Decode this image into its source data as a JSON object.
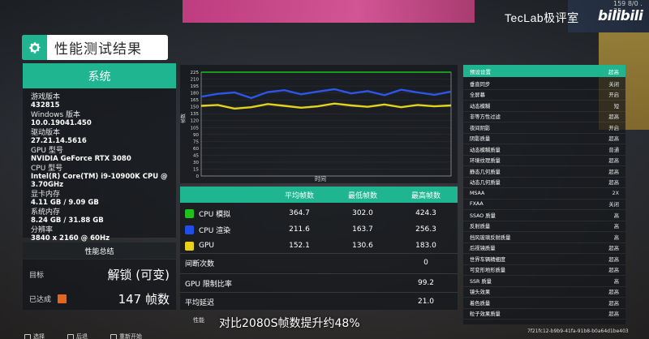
{
  "header": {
    "title": "性能测试结果",
    "watermark": "TecLab极评室",
    "brand": "bilibili",
    "top_corner": "159 8/0 . 35"
  },
  "system": {
    "heading": "系统",
    "rows": [
      {
        "label": "游戏版本",
        "value": "432815"
      },
      {
        "label": "Windows 版本",
        "value": "10.0.19041.450"
      },
      {
        "label": "驱动版本",
        "value": "27.21.14.5616"
      },
      {
        "label": "GPU 型号",
        "value": "NVIDIA GeForce RTX 3080"
      },
      {
        "label": "CPU 型号",
        "value": "Intel(R) Core(TM) i9-10900K CPU @ 3.70GHz"
      },
      {
        "label": "显卡内存",
        "value": "4.11 GB / 9.09 GB"
      },
      {
        "label": "系统内存",
        "value": "8.24 GB / 31.88 GB"
      },
      {
        "label": "分辨率",
        "value": "3840 x 2160 @ 60Hz"
      }
    ]
  },
  "summary": {
    "heading": "性能总结",
    "target_label": "目标",
    "target_value": "解锁 (可变)",
    "achieved_label": "已达成",
    "achieved_value": "147 帧数"
  },
  "graph": {
    "ylabel": "帧数",
    "xlabel": "时间",
    "y_ticks": [
      "225",
      "210",
      "195",
      "180",
      "165",
      "150",
      "135",
      "120",
      "105",
      "90",
      "75",
      "60",
      "45",
      "30",
      "15",
      "0"
    ]
  },
  "chart_data": {
    "type": "line",
    "xlabel": "时间",
    "ylabel": "帧数",
    "ylim": [
      0,
      225
    ],
    "series": [
      {
        "name": "CPU 模拟",
        "color": "#18c21a",
        "values": [
          365,
          366,
          364,
          365,
          363,
          366,
          365,
          364,
          366,
          365,
          364,
          365,
          366,
          364,
          365,
          365
        ]
      },
      {
        "name": "CPU 渲染",
        "color": "#2d55e8",
        "values": [
          172,
          178,
          181,
          169,
          182,
          186,
          177,
          183,
          188,
          179,
          184,
          175,
          187,
          181,
          176,
          183
        ]
      },
      {
        "name": "GPU",
        "color": "#e2d41c",
        "values": [
          152,
          154,
          146,
          149,
          156,
          152,
          148,
          151,
          157,
          153,
          150,
          155,
          149,
          154,
          151,
          153
        ]
      }
    ]
  },
  "fps_table": {
    "headers": [
      "",
      "平均帧数",
      "最低帧数",
      "最高帧数"
    ],
    "rows": [
      {
        "name": "CPU 模拟",
        "color": "#1fc11c",
        "avg": "364.7",
        "min": "302.0",
        "max": "424.3"
      },
      {
        "name": "CPU 渲染",
        "color": "#1f4ee8",
        "avg": "211.6",
        "min": "163.7",
        "max": "256.3"
      },
      {
        "name": "GPU",
        "color": "#e6d21a",
        "avg": "152.1",
        "min": "130.6",
        "max": "183.0"
      }
    ],
    "stutter_label": "间断次数",
    "stutter_value": "0",
    "gpu_limit_label": "GPU 限制比率",
    "gpu_limit_value": "99.2",
    "latency_label": "平均延迟",
    "latency_value": "21.0"
  },
  "preset": {
    "heading": "预设设置",
    "heading_value": "超高",
    "rows": [
      {
        "label": "垂直同步",
        "value": "关闭"
      },
      {
        "label": "全屏幕",
        "value": "开启"
      },
      {
        "label": "动态模糊",
        "value": "短"
      },
      {
        "label": "非等方性过滤",
        "value": "超高"
      },
      {
        "label": "夜间阴影",
        "value": "开启"
      },
      {
        "label": "阴影质量",
        "value": "超高"
      },
      {
        "label": "动态模糊质量",
        "value": "普通"
      },
      {
        "label": "环境纹理质量",
        "value": "超高"
      },
      {
        "label": "静态几何质量",
        "value": "超高"
      },
      {
        "label": "动态几何质量",
        "value": "超高"
      },
      {
        "label": "MSAA",
        "value": "2X"
      },
      {
        "label": "FXAA",
        "value": "关闭"
      },
      {
        "label": "SSAO 质量",
        "value": "高"
      },
      {
        "label": "反射质量",
        "value": "高"
      },
      {
        "label": "挡风玻璃反射质量",
        "value": "高"
      },
      {
        "label": "后视镜质量",
        "value": "超高"
      },
      {
        "label": "世界车辆精细度",
        "value": "超高"
      },
      {
        "label": "可变形地形质量",
        "value": "超高"
      },
      {
        "label": "SSR 质量",
        "value": "高"
      },
      {
        "label": "镜头效果",
        "value": "超高"
      },
      {
        "label": "着色质量",
        "value": "超高"
      },
      {
        "label": "粒子效果质量",
        "value": "超高"
      }
    ]
  },
  "footer": {
    "subtitle": "对比2080S帧数提升约48%",
    "subtitle_prefix": "性能",
    "hash": "7f21fc12-b9b9-41fa-91b8-b0a64d1be403",
    "icons": [
      "选择",
      "后退",
      "重新开始"
    ]
  }
}
